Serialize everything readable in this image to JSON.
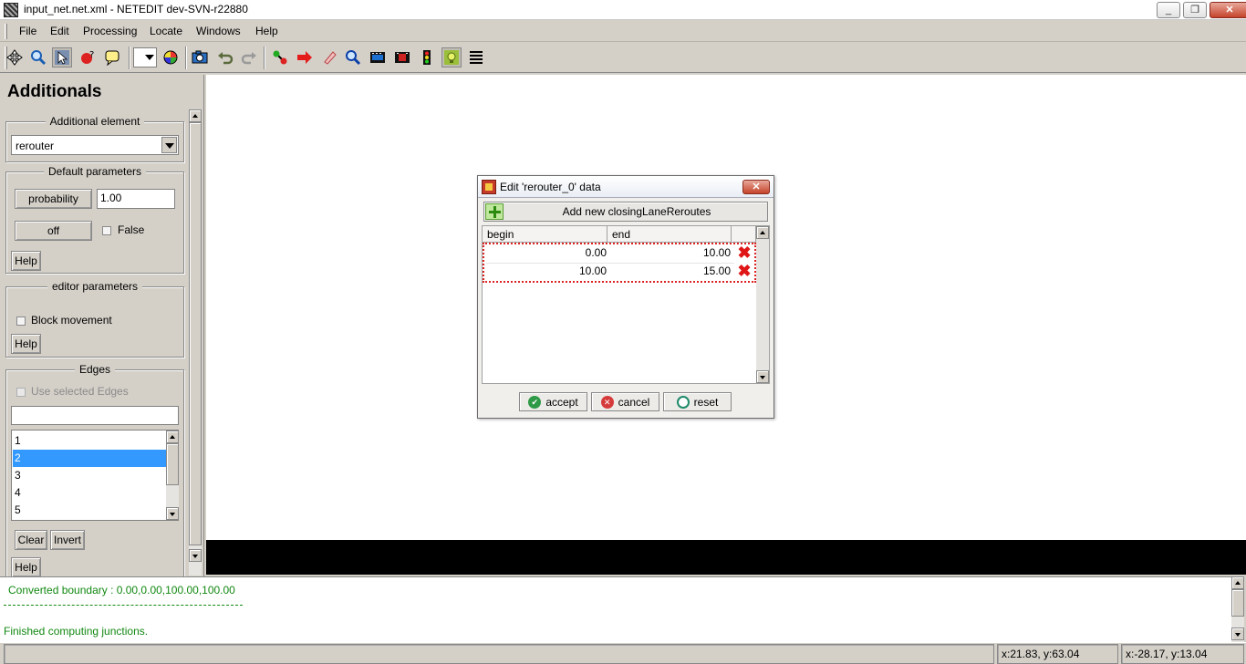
{
  "window": {
    "title": "input_net.net.xml - NETEDIT dev-SVN-r22880",
    "minimize": "_",
    "restore": "❐",
    "close": "✕"
  },
  "menu": [
    {
      "label": "File"
    },
    {
      "label": "Edit"
    },
    {
      "label": "Processing"
    },
    {
      "label": "Locate"
    },
    {
      "label": "Windows"
    },
    {
      "label": "Help"
    }
  ],
  "toolbar": {
    "icons": [
      "move-mode",
      "inspect-mode",
      "select-mode",
      "delete-mode",
      "additional-mode",
      "color-scheme",
      "screenshot",
      "undo",
      "redo",
      "locate-junction",
      "locate-edge",
      "locate-vehicle",
      "locate-route",
      "locate-poi",
      "locate-tls",
      "traffic-light",
      "locate-additional",
      "view-settings"
    ]
  },
  "left_panel": {
    "title": "Additionals",
    "additional_element": {
      "legend": "Additional element",
      "selected": "rerouter"
    },
    "default_parameters": {
      "legend": "Default parameters",
      "probability_label": "probability",
      "probability_value": "1.00",
      "off_label": "off",
      "off_checkbox_label": "False",
      "help": "Help"
    },
    "editor_parameters": {
      "legend": "editor parameters",
      "block_movement": "Block movement",
      "help": "Help"
    },
    "edges": {
      "legend": "Edges",
      "use_selected": "Use selected Edges",
      "search_value": "",
      "items": [
        "1",
        "2",
        "3",
        "4",
        "5"
      ],
      "selected_index": 1,
      "clear": "Clear",
      "invert": "Invert",
      "help": "Help"
    }
  },
  "messages": {
    "line1": "Converted boundary : 0.00,0.00,100.00,100.00",
    "line2": "Finished computing junctions."
  },
  "status": {
    "left": "",
    "coords1": "x:21.83, y:63.04",
    "coords2": "x:-28.17, y:13.04"
  },
  "dialog": {
    "title": "Edit 'rerouter_0' data",
    "close": "✕",
    "add_button": "Add new closingLaneReroutes",
    "columns": [
      "begin",
      "end"
    ],
    "rows": [
      {
        "begin": "0.00",
        "end": "10.00"
      },
      {
        "begin": "10.00",
        "end": "15.00"
      }
    ],
    "accept": "accept",
    "cancel": "cancel",
    "reset": "reset"
  },
  "colors": {
    "message_text": "#118811",
    "delete_icon": "#e01515",
    "selection": "#3399ff"
  }
}
